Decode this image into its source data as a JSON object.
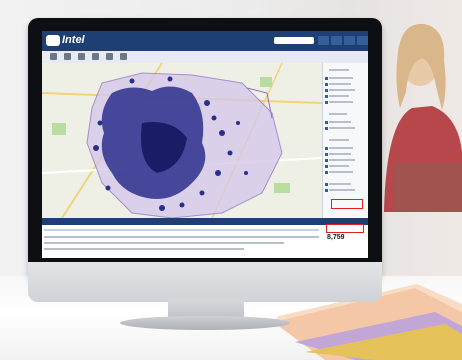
{
  "app": {
    "logo_mark": "",
    "name": "Intel"
  },
  "map": {
    "total_count": "8,759"
  }
}
